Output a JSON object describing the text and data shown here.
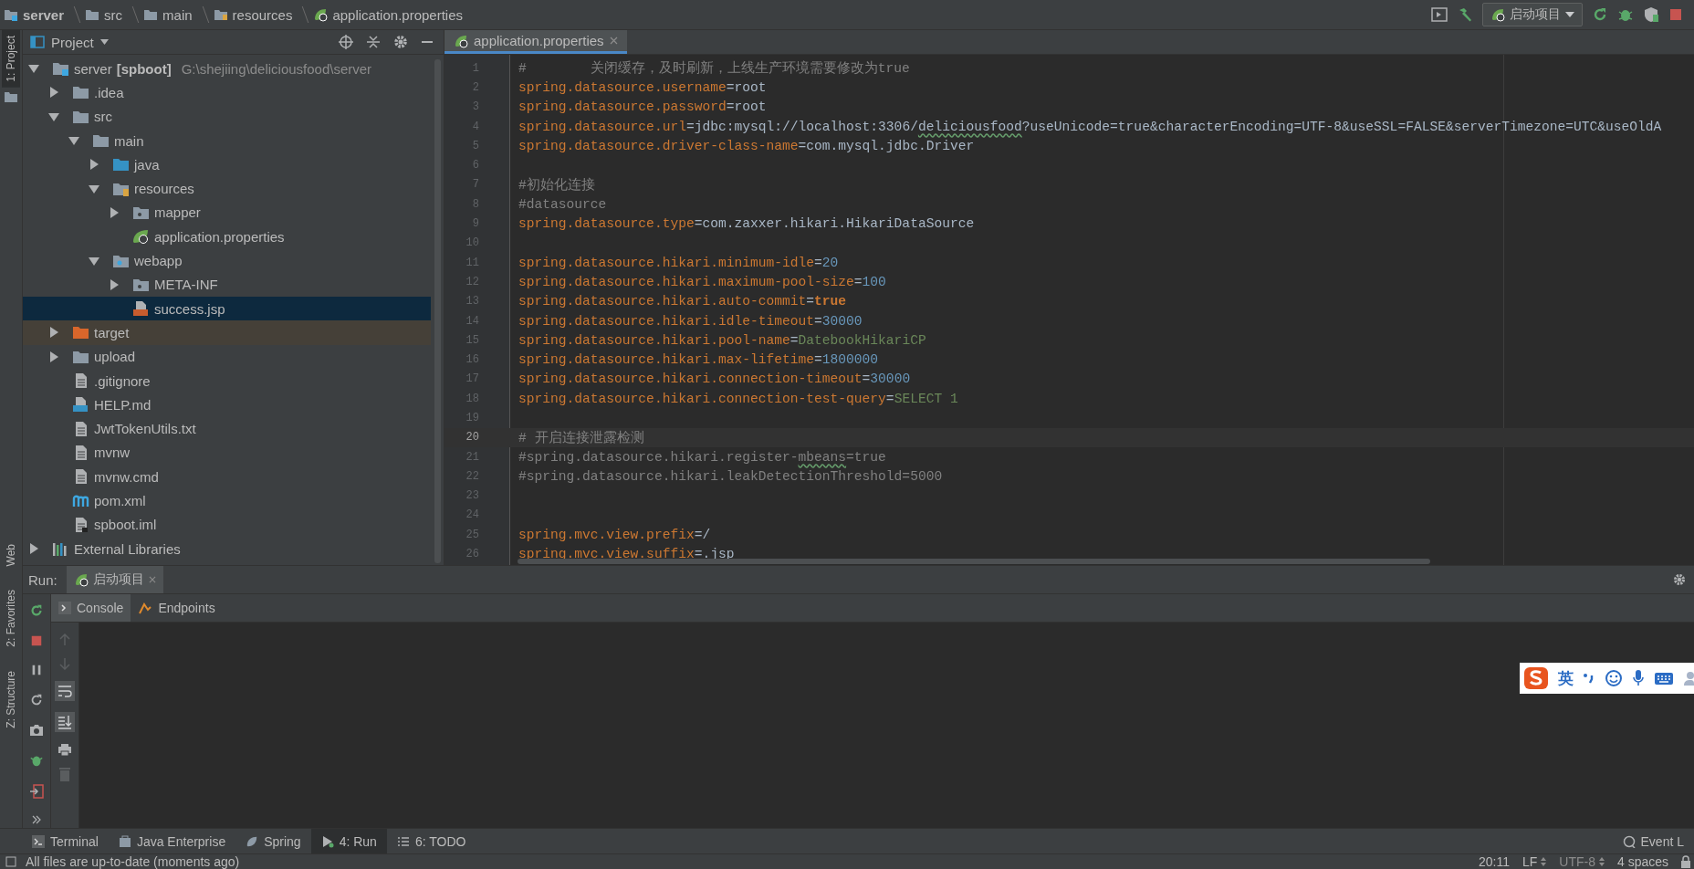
{
  "breadcrumbs": [
    {
      "label": "server",
      "kind": "module"
    },
    {
      "label": "src",
      "kind": "folder"
    },
    {
      "label": "main",
      "kind": "folder"
    },
    {
      "label": "resources",
      "kind": "resources"
    },
    {
      "label": "application.properties",
      "kind": "spring"
    }
  ],
  "run_config": {
    "label": "启动项目"
  },
  "side_tools_top": [
    {
      "label": "1: Project",
      "selected": true
    }
  ],
  "side_tools_bottom": [
    {
      "label": "Web",
      "selected": false
    },
    {
      "label": "2: Favorites",
      "selected": false
    },
    {
      "label": "Z: Structure",
      "selected": false
    }
  ],
  "project_panel": {
    "title": "Project"
  },
  "tree": [
    {
      "name": "server",
      "module": "[spboot]",
      "path": "G:\\shejiing\\deliciousfood\\server",
      "kind": "module",
      "expanded": true,
      "selected": false,
      "children": [
        {
          "name": ".idea",
          "kind": "folder",
          "expanded": false,
          "selected": false
        },
        {
          "name": "src",
          "kind": "folder",
          "expanded": true,
          "selected": false,
          "children": [
            {
              "name": "main",
              "kind": "folder",
              "expanded": true,
              "selected": false,
              "children": [
                {
                  "name": "java",
                  "kind": "source",
                  "expanded": false,
                  "selected": false
                },
                {
                  "name": "resources",
                  "kind": "resources",
                  "expanded": true,
                  "selected": false,
                  "children": [
                    {
                      "name": "mapper",
                      "kind": "package",
                      "expanded": false,
                      "selected": false
                    },
                    {
                      "name": "application.properties",
                      "kind": "spring",
                      "selected": false
                    }
                  ]
                },
                {
                  "name": "webapp",
                  "kind": "web",
                  "expanded": true,
                  "selected": false,
                  "children": [
                    {
                      "name": "META-INF",
                      "kind": "package",
                      "expanded": false,
                      "selected": false
                    },
                    {
                      "name": "success.jsp",
                      "kind": "jsp",
                      "selected": true
                    }
                  ]
                }
              ]
            }
          ]
        },
        {
          "name": "target",
          "kind": "excluded",
          "expanded": false,
          "selected": false
        },
        {
          "name": "upload",
          "kind": "folder",
          "expanded": false,
          "selected": false
        },
        {
          "name": ".gitignore",
          "kind": "file",
          "selected": false
        },
        {
          "name": "HELP.md",
          "kind": "md",
          "selected": false
        },
        {
          "name": "JwtTokenUtils.txt",
          "kind": "file",
          "selected": false
        },
        {
          "name": "mvnw",
          "kind": "file",
          "selected": false
        },
        {
          "name": "mvnw.cmd",
          "kind": "file",
          "selected": false
        },
        {
          "name": "pom.xml",
          "kind": "maven",
          "selected": false
        },
        {
          "name": "spboot.iml",
          "kind": "iml",
          "selected": false
        }
      ]
    },
    {
      "name": "External Libraries",
      "kind": "libraries",
      "expanded": false,
      "selected": false
    }
  ],
  "editor_tabs": [
    {
      "label": "application.properties",
      "selected": true
    }
  ],
  "code_lines": [
    {
      "no": "1",
      "current": false,
      "segs": [
        {
          "kind": "comment",
          "text": "#        关闭缓存，及时刷新，上线生产环境需要修改为true"
        }
      ]
    },
    {
      "no": "2",
      "current": false,
      "segs": [
        {
          "kind": "key",
          "text": "spring.datasource.username"
        },
        {
          "kind": "value",
          "text": "=root"
        }
      ]
    },
    {
      "no": "3",
      "current": false,
      "segs": [
        {
          "kind": "key",
          "text": "spring.datasource.password"
        },
        {
          "kind": "value",
          "text": "=root"
        }
      ]
    },
    {
      "no": "4",
      "current": false,
      "segs": [
        {
          "kind": "key",
          "text": "spring.datasource.url"
        },
        {
          "kind": "value",
          "text": "=jdbc:mysql://localhost:3306/"
        },
        {
          "kind": "value-typo",
          "text": "deliciousfood"
        },
        {
          "kind": "value",
          "text": "?useUnicode=true&characterEncoding=UTF-8&useSSL=FALSE&serverTimezone=UTC&useOldA"
        }
      ]
    },
    {
      "no": "5",
      "current": false,
      "segs": [
        {
          "kind": "key",
          "text": "spring.datasource.driver-class-name"
        },
        {
          "kind": "value",
          "text": "=com.mysql.jdbc.Driver"
        }
      ]
    },
    {
      "no": "6",
      "current": false
    },
    {
      "no": "7",
      "current": false,
      "segs": [
        {
          "kind": "comment",
          "text": "#初始化连接"
        }
      ]
    },
    {
      "no": "8",
      "current": false,
      "segs": [
        {
          "kind": "comment",
          "text": "#datasource"
        }
      ]
    },
    {
      "no": "9",
      "current": false,
      "segs": [
        {
          "kind": "key",
          "text": "spring.datasource.type"
        },
        {
          "kind": "value",
          "text": "=com.zaxxer.hikari.HikariDataSource"
        }
      ]
    },
    {
      "no": "10",
      "current": false
    },
    {
      "no": "11",
      "current": false,
      "segs": [
        {
          "kind": "key",
          "text": "spring.datasource.hikari.minimum-idle"
        },
        {
          "kind": "value",
          "text": "="
        },
        {
          "kind": "number",
          "text": "20"
        }
      ]
    },
    {
      "no": "12",
      "current": false,
      "segs": [
        {
          "kind": "key",
          "text": "spring.datasource.hikari.maximum-pool-size"
        },
        {
          "kind": "value",
          "text": "="
        },
        {
          "kind": "number",
          "text": "100"
        }
      ]
    },
    {
      "no": "13",
      "current": false,
      "segs": [
        {
          "kind": "key",
          "text": "spring.datasource.hikari.auto-commit"
        },
        {
          "kind": "value",
          "text": "="
        },
        {
          "kind": "keyword",
          "text": "true"
        }
      ]
    },
    {
      "no": "14",
      "current": false,
      "segs": [
        {
          "kind": "key",
          "text": "spring.datasource.hikari.idle-timeout"
        },
        {
          "kind": "value",
          "text": "="
        },
        {
          "kind": "number",
          "text": "30000"
        }
      ]
    },
    {
      "no": "15",
      "current": false,
      "segs": [
        {
          "kind": "key",
          "text": "spring.datasource.hikari.pool-name"
        },
        {
          "kind": "value",
          "text": "="
        },
        {
          "kind": "string",
          "text": "DatebookHikariCP"
        }
      ]
    },
    {
      "no": "16",
      "current": false,
      "segs": [
        {
          "kind": "key",
          "text": "spring.datasource.hikari.max-lifetime"
        },
        {
          "kind": "value",
          "text": "="
        },
        {
          "kind": "number",
          "text": "1800000"
        }
      ]
    },
    {
      "no": "17",
      "current": false,
      "segs": [
        {
          "kind": "key",
          "text": "spring.datasource.hikari.connection-timeout"
        },
        {
          "kind": "value",
          "text": "="
        },
        {
          "kind": "number",
          "text": "30000"
        }
      ]
    },
    {
      "no": "18",
      "current": false,
      "segs": [
        {
          "kind": "key",
          "text": "spring.datasource.hikari.connection-test-query"
        },
        {
          "kind": "value",
          "text": "="
        },
        {
          "kind": "string",
          "text": "SELECT 1"
        }
      ]
    },
    {
      "no": "19",
      "current": false
    },
    {
      "no": "20",
      "current": true,
      "segs": [
        {
          "kind": "comment",
          "text": "# 开启连接泄露检测"
        }
      ]
    },
    {
      "no": "21",
      "current": false,
      "segs": [
        {
          "kind": "comment",
          "text": "#spring.datasource.hikari.register-"
        },
        {
          "kind": "comment-typo",
          "text": "mbeans"
        },
        {
          "kind": "comment",
          "text": "=true"
        }
      ]
    },
    {
      "no": "22",
      "current": false,
      "segs": [
        {
          "kind": "comment",
          "text": "#spring.datasource.hikari.leakDetectionThreshold=5000"
        }
      ]
    },
    {
      "no": "23",
      "current": false
    },
    {
      "no": "24",
      "current": false
    },
    {
      "no": "25",
      "current": false,
      "segs": [
        {
          "kind": "key",
          "text": "spring.mvc.view.prefix"
        },
        {
          "kind": "value",
          "text": "=/"
        }
      ]
    },
    {
      "no": "26",
      "current": false,
      "segs": [
        {
          "kind": "key",
          "text": "spring.mvc.view.suffix"
        },
        {
          "kind": "value",
          "text": "=.jsp"
        }
      ]
    }
  ],
  "run_panel": {
    "label": "Run:",
    "tabs": [
      {
        "label": "启动项目",
        "selected": true
      }
    ],
    "sub_tabs": [
      {
        "label": "Console",
        "kind": "console",
        "selected": true
      },
      {
        "label": "Endpoints",
        "kind": "endpoints",
        "selected": false
      }
    ]
  },
  "ime_toolbar": {
    "mode": "英"
  },
  "tool_tabs": [
    {
      "label": "Terminal",
      "kind": "terminal",
      "selected": false
    },
    {
      "label": "Java Enterprise",
      "kind": "enterprise",
      "selected": false
    },
    {
      "label": "Spring",
      "kind": "spring",
      "selected": false
    },
    {
      "label": "4: Run",
      "kind": "run",
      "selected": true
    },
    {
      "label": "6: TODO",
      "kind": "todo",
      "selected": false
    }
  ],
  "event_log": {
    "label": "Event L"
  },
  "status_bar": {
    "message": "All files are up-to-date (moments ago)",
    "position": "20:11",
    "line_ending": "LF",
    "encoding": "UTF-8",
    "indent": "4 spaces"
  }
}
